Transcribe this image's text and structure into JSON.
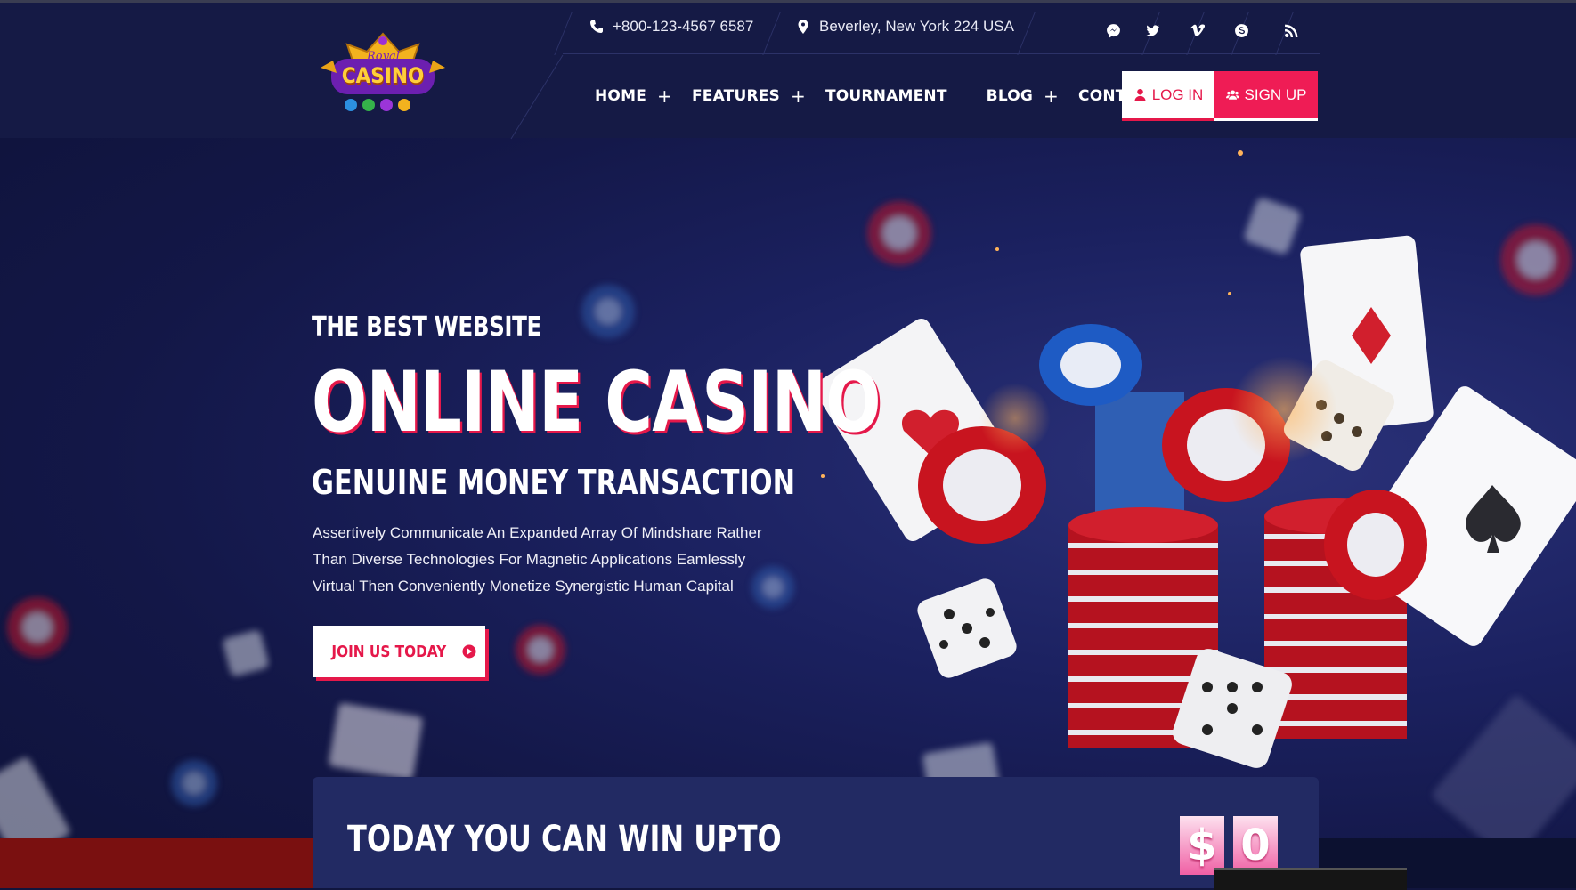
{
  "header": {
    "logo_top": "Royal",
    "logo_main": "CASINO",
    "phone": "+800-123-4567 6587",
    "address": "Beverley, New York 224 USA",
    "social_icons": [
      "messenger-icon",
      "twitter-icon",
      "vimeo-icon",
      "skype-icon",
      "rss-icon"
    ],
    "nav": [
      {
        "label": "HOME",
        "has_submenu": true
      },
      {
        "label": "FEATURES",
        "has_submenu": true
      },
      {
        "label": "TOURNAMENT",
        "has_submenu": false
      },
      {
        "label": "BLOG",
        "has_submenu": true
      },
      {
        "label": "CONTACT",
        "has_submenu": false
      }
    ],
    "plus": "+",
    "login_label": "LOG IN",
    "signup_label": "SIGN UP"
  },
  "hero": {
    "subtitle": "THE BEST WEBSITE",
    "title": "ONLINE CASINO",
    "tagline": "GENUINE MONEY TRANSACTION",
    "description": [
      "Assertively Communicate An Expanded Array Of Mindshare Rather",
      "Than Diverse Technologies For Magnetic Applications Eamlessly",
      "Virtual Then Conveniently Monetize Synergistic Human Capital"
    ],
    "cta_label": "JOIN US TODAY"
  },
  "win": {
    "title": "TODAY YOU CAN WIN UPTO",
    "digits": [
      "$",
      "0"
    ]
  },
  "colors": {
    "accent": "#ef1c55",
    "background": "#11153d",
    "header": "#151a45",
    "panel": "#222a63"
  }
}
